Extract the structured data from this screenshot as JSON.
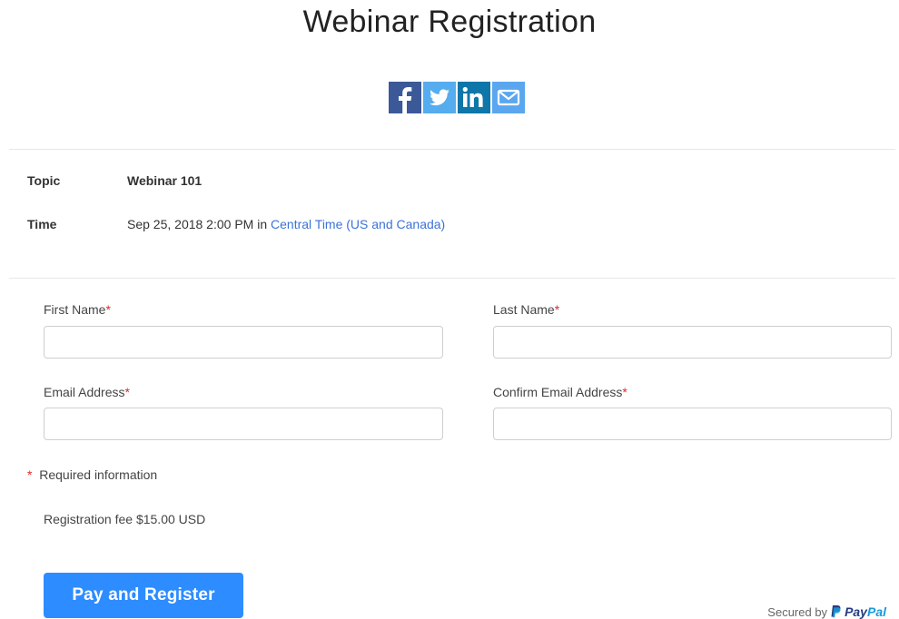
{
  "page": {
    "title": "Webinar Registration"
  },
  "share": {
    "icons": [
      {
        "name": "facebook-icon",
        "label": "f",
        "color": "#3b5998"
      },
      {
        "name": "twitter-icon",
        "label": "twitter",
        "color": "#55acee"
      },
      {
        "name": "linkedin-icon",
        "label": "in",
        "color": "#0e76a8"
      },
      {
        "name": "email-icon",
        "label": "email",
        "color": "#5aa7f0"
      }
    ]
  },
  "info": {
    "topic_label": "Topic",
    "topic_value": "Webinar 101",
    "time_label": "Time",
    "time_value": "Sep 25, 2018 2:00 PM",
    "time_in": "in",
    "timezone_link": "Central Time (US and Canada)"
  },
  "form": {
    "first_name_label": "First Name",
    "last_name_label": "Last Name",
    "email_label": "Email Address",
    "confirm_email_label": "Confirm Email Address",
    "required_marker": "*",
    "first_name_value": "",
    "last_name_value": "",
    "email_value": "",
    "confirm_email_value": ""
  },
  "notes": {
    "required_info": "Required information",
    "fee": "Registration fee $15.00 USD"
  },
  "actions": {
    "pay_button": "Pay and Register"
  },
  "footer": {
    "secured_by": "Secured by",
    "paypal_pay": "Pay",
    "paypal_pal": "Pal"
  },
  "colors": {
    "accent": "#2d8cff",
    "link": "#3b73d6",
    "required": "#e02828"
  }
}
